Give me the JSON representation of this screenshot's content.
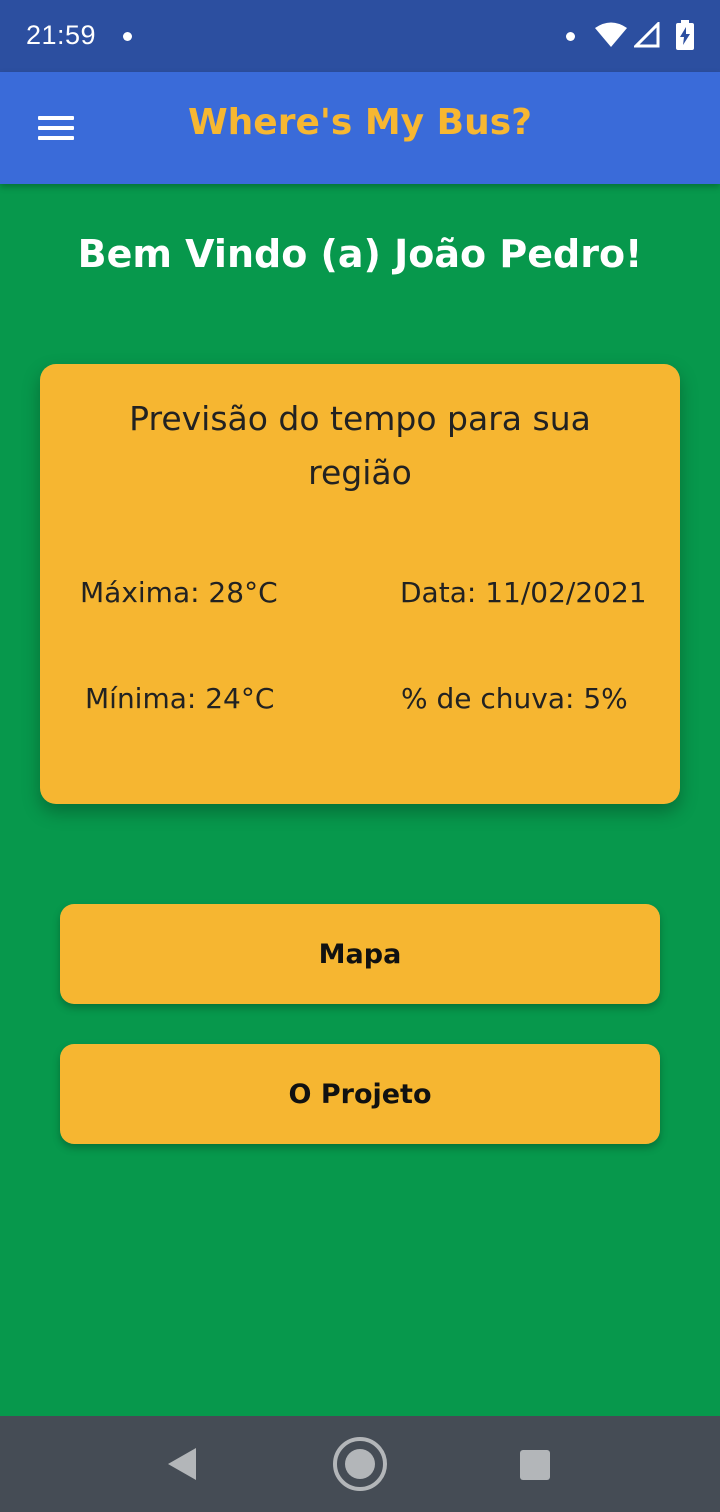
{
  "status_bar": {
    "time": "21:59",
    "icons": [
      "notification-dot-icon",
      "wifi-icon",
      "signal-icon",
      "battery-charging-icon"
    ]
  },
  "app_bar": {
    "title": "Where's My Bus?",
    "menu_icon": "hamburger-menu-icon"
  },
  "welcome": "Bem Vindo (a) João Pedro!",
  "weather": {
    "title": "Previsão do tempo para sua região",
    "max": "Máxima: 28°C",
    "date": "Data: 11/02/2021",
    "min": "Mínima: 24°C",
    "rain": "% de chuva: 5%"
  },
  "buttons": {
    "map": "Mapa",
    "project": "O Projeto"
  },
  "nav_bar": {
    "icons": [
      "back-icon",
      "home-icon",
      "recents-icon"
    ]
  },
  "colors": {
    "status_bar": "#2c4fa0",
    "app_bar": "#3a6bd9",
    "title_accent": "#f7b731",
    "background": "#07984c",
    "card": "#f6b631",
    "nav_bar": "#454c55"
  }
}
